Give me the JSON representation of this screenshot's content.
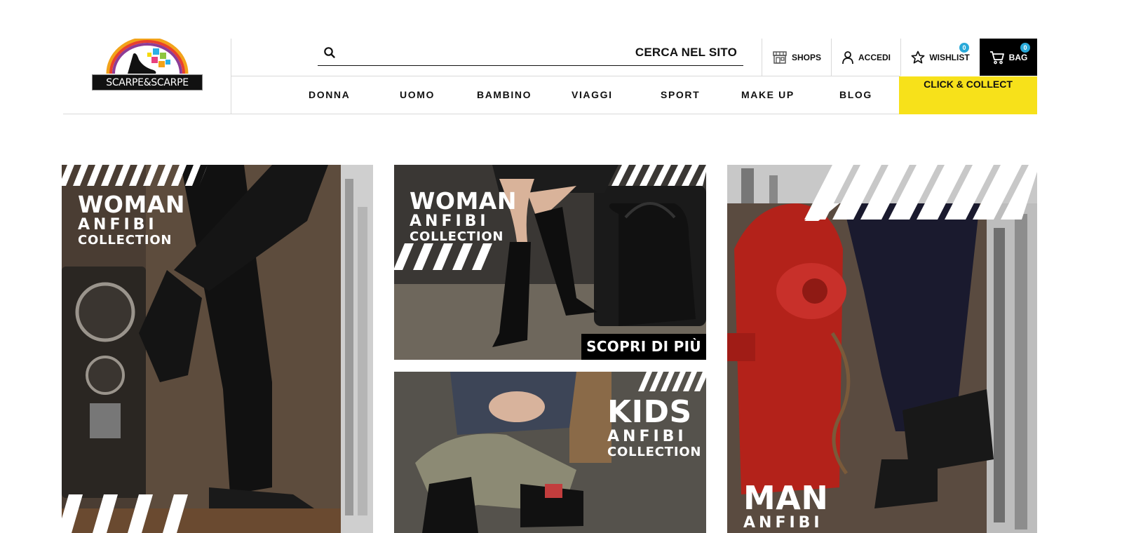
{
  "logo": {
    "text": "SCARPE&SCARPE"
  },
  "search": {
    "placeholder": "CERCA NEL SITO"
  },
  "utility": {
    "shops": "SHOPS",
    "accedi": "ACCEDI",
    "wishlist": "WISHLIST",
    "wishlist_count": "0",
    "bag": "BAG",
    "bag_count": "0"
  },
  "nav": {
    "items": [
      "DONNA",
      "UOMO",
      "BAMBINO",
      "VIAGGI",
      "SPORT",
      "MAKE UP",
      "BLOG"
    ],
    "click_collect": "CLICK & COLLECT"
  },
  "tiles": {
    "woman_boots": {
      "line1": "WOMAN",
      "line2": "ANFIBI",
      "line3": "COLLECTION"
    },
    "woman_tall": {
      "line1": "WOMAN",
      "line2": "ANFIBI",
      "line3": "COLLECTION",
      "cta": "SCOPRI DI PIÙ"
    },
    "kids": {
      "line1": "KIDS",
      "line2": "ANFIBI",
      "line3": "COLLECTION"
    },
    "man": {
      "line1": "MAN",
      "line2": "ANFIBI"
    }
  },
  "colors": {
    "accent_yellow": "#f7e11a",
    "badge_blue": "#29a9d9",
    "black": "#000000"
  },
  "icons": [
    "search-icon",
    "shop-icon",
    "user-icon",
    "star-icon",
    "cart-icon"
  ]
}
